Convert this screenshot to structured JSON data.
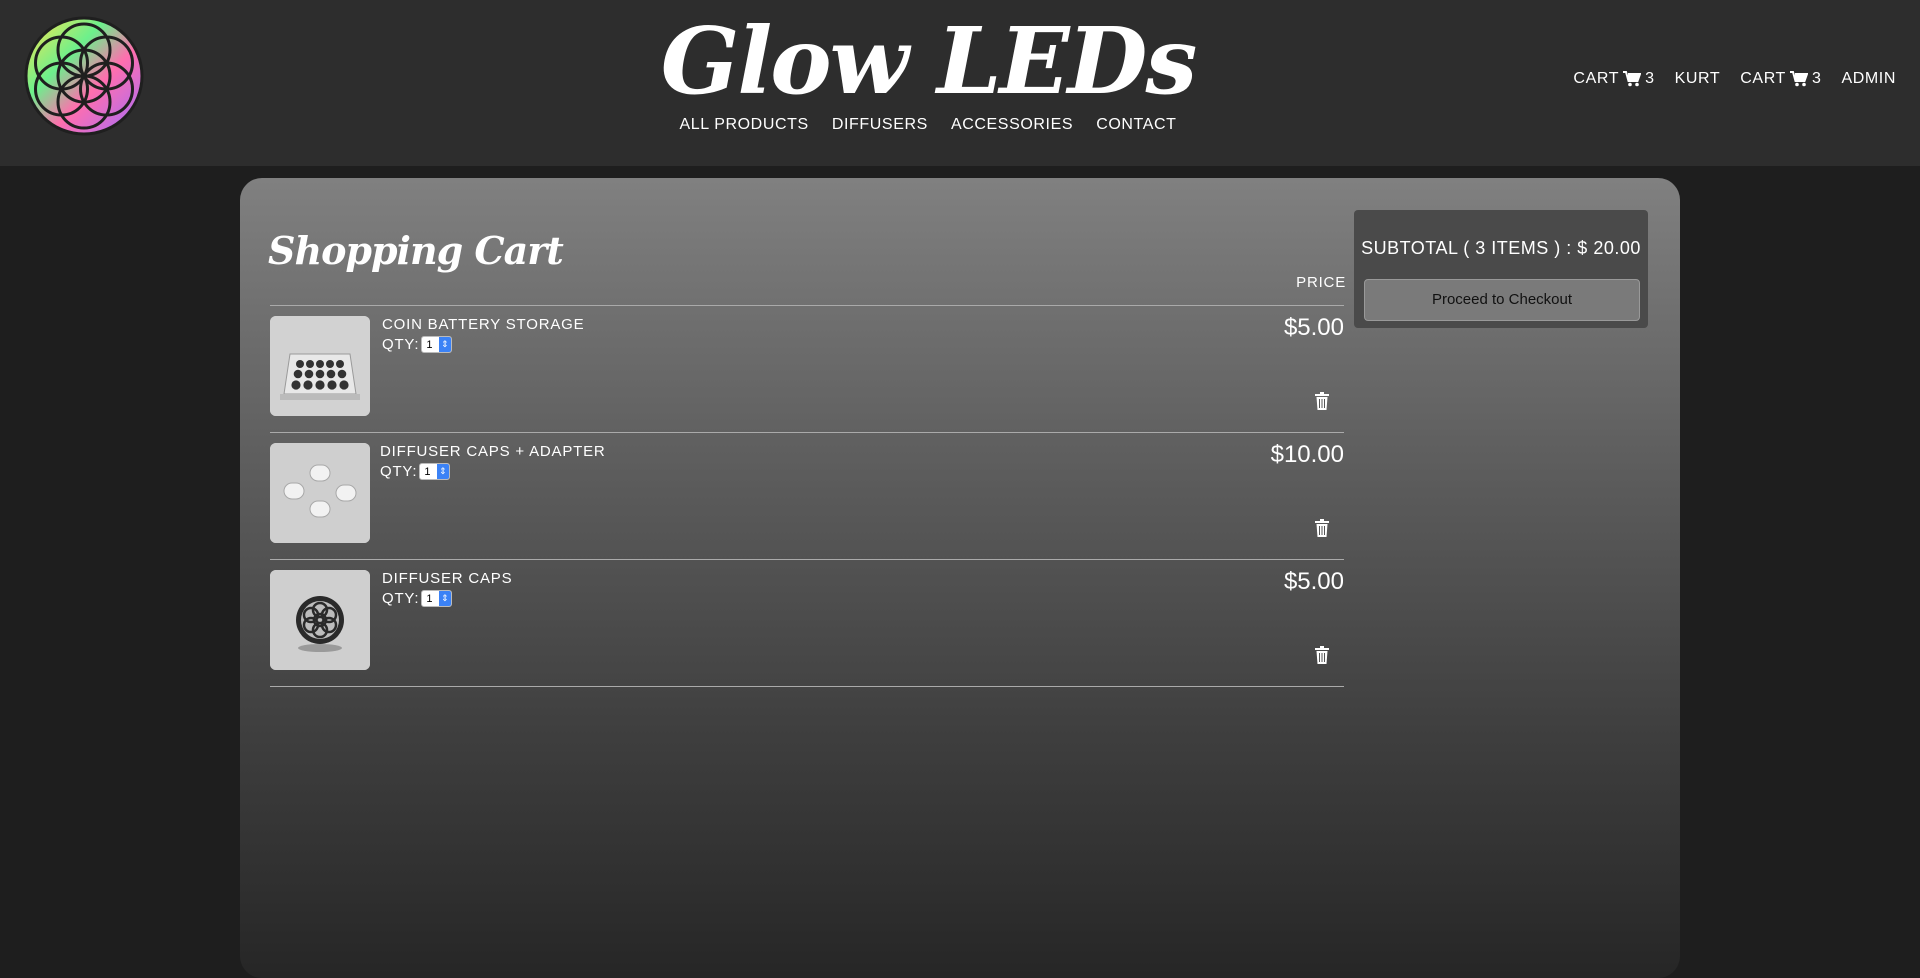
{
  "brand": "Glow LEDs",
  "colors": {
    "header_bg": "#2d2d2d",
    "page_bg": "#1e1e1e",
    "select_accent": "#3b82f6"
  },
  "nav": {
    "main": [
      "ALL PRODUCTS",
      "DIFFUSERS",
      "ACCESSORIES",
      "CONTACT"
    ],
    "right": {
      "cart1_label": "CART",
      "cart1_count": "3",
      "user": "KURT",
      "cart2_label": "CART",
      "cart2_count": "3",
      "admin": "ADMIN"
    }
  },
  "cart": {
    "title": "Shopping Cart",
    "price_header": "PRICE",
    "items": [
      {
        "name": "COIN BATTERY STORAGE",
        "qty_label": "QTY:",
        "qty": "1",
        "price": "$5.00",
        "image": "coin-battery-storage-tray"
      },
      {
        "name": "DIFFUSER CAPS + ADAPTER",
        "qty_label": "QTY:",
        "qty": "1",
        "price": "$10.00",
        "image": "diffuser-caps-adapter"
      },
      {
        "name": "DIFFUSER CAPS",
        "qty_label": "QTY:",
        "qty": "1",
        "price": "$5.00",
        "image": "diffuser-cap"
      }
    ]
  },
  "summary": {
    "subtotal": "SUBTOTAL ( 3 ITEMS ) : $ 20.00",
    "checkout_label": "Proceed to Checkout"
  }
}
